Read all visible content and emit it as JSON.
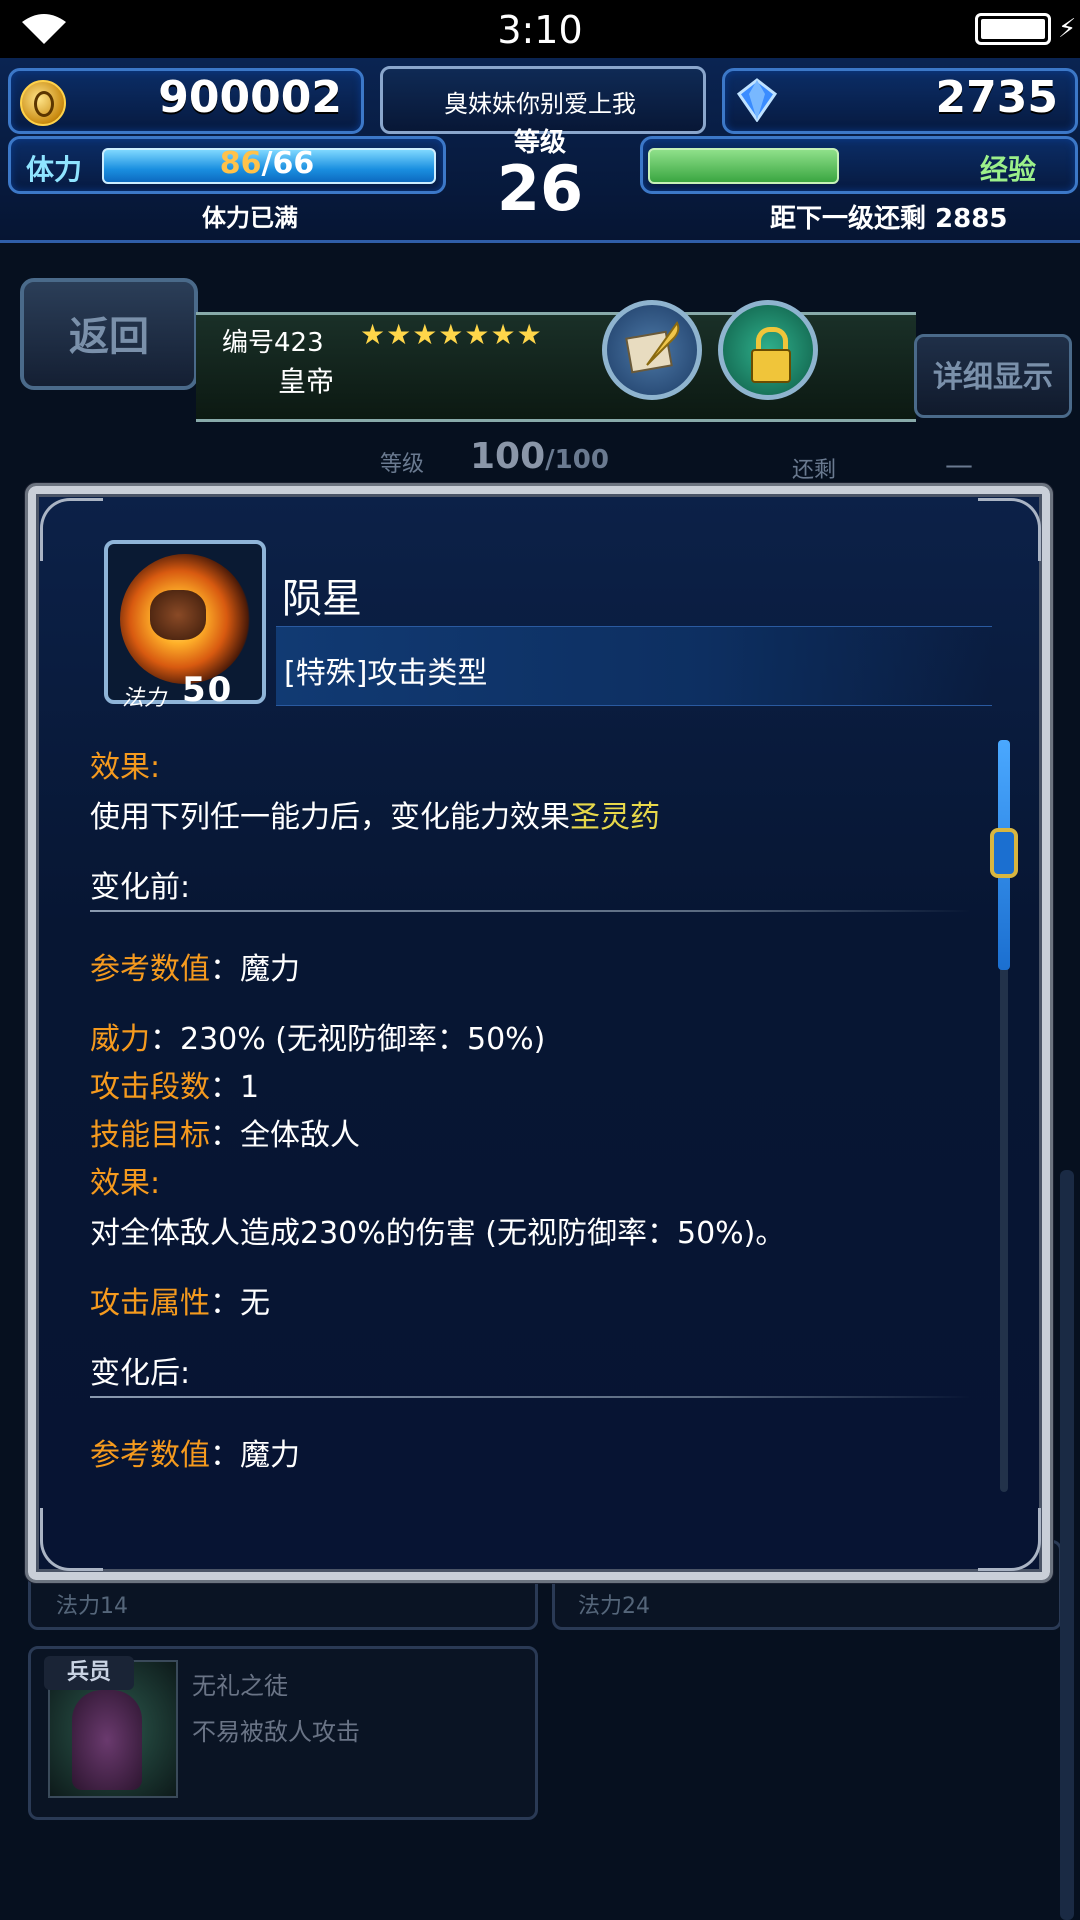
{
  "status_bar": {
    "time": "3:10"
  },
  "hud": {
    "gil": "900002",
    "gems": "2735",
    "player_name": "臭妹妹你别爱上我",
    "level_label": "等级",
    "level": "26",
    "stamina_label": "体力",
    "stamina_current": "86",
    "stamina_max": "/66",
    "stamina_status": "体力已满",
    "stamina_fill": 1.0,
    "exp_label": "经验",
    "exp_remaining": "距下一级还剩 2885",
    "exp_fill": 0.52
  },
  "unit_panel": {
    "back_label": "返回",
    "number": "编号423",
    "stars": "★★★★★★★",
    "name": "皇帝",
    "detail_label": "详细显示",
    "level_label": "等级",
    "level_value": "100",
    "level_max": "/100",
    "remain_label": "还剩",
    "remain_value": "—"
  },
  "background_cards": {
    "mp_left": "法力14",
    "mp_right": "法力24",
    "sub_tag": "兵员",
    "sub_title": "无礼之徒",
    "sub_desc": "不易被敌人攻击"
  },
  "skill_dialog": {
    "name": "陨星",
    "type": "[特殊]攻击类型",
    "mp_label": "法力",
    "mp_value": "50",
    "effect_label": "效果",
    "effect_text": "使用下列任一能力后，变化能力效果",
    "effect_highlight": "圣灵药",
    "before_label": "变化前:",
    "ref_label": "参考数值",
    "ref_value": "魔力",
    "power_label": "威力",
    "power_value": "230% (无视防御率：50%)",
    "hits_label": "攻击段数",
    "hits_value": "1",
    "target_label": "技能目标",
    "target_value": "全体敌人",
    "effect2_label": "效果",
    "effect2_text": "对全体敌人造成230%的伤害 (无视防御率：50%)。",
    "element_label": "攻击属性",
    "element_value": "无",
    "after_label": "变化后:",
    "ref2_label": "参考数值",
    "ref2_value": "魔力",
    "colon": "："
  },
  "colors": {
    "key": "#f59a1e",
    "highlight": "#e7d84a",
    "accent": "#3c78c8"
  },
  "icons": [
    "wifi-icon",
    "battery-icon",
    "gil-coin-icon",
    "gem-icon",
    "quill-icon",
    "lock-icon",
    "meteor-icon"
  ]
}
